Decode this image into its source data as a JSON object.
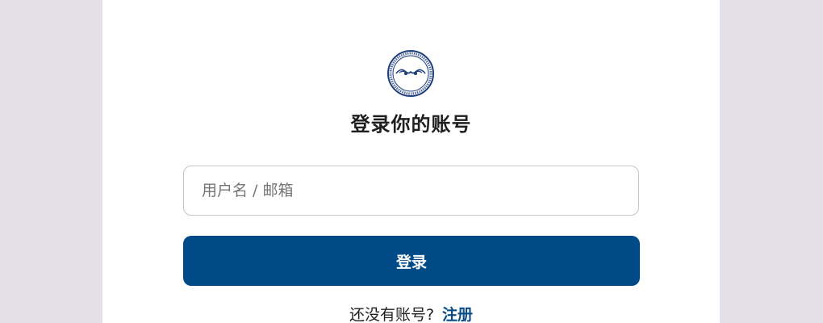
{
  "login": {
    "title": "登录你的账号",
    "username_placeholder": "用户名 / 邮箱",
    "login_button": "登录",
    "no_account_text": "还没有账号?",
    "signup_link": "注册"
  },
  "colors": {
    "background": "#e3e0ea",
    "card": "#ffffff",
    "primary_button": "#004b87",
    "link": "#0a4d86"
  },
  "icons": {
    "logo": "circular-seal-logo"
  }
}
